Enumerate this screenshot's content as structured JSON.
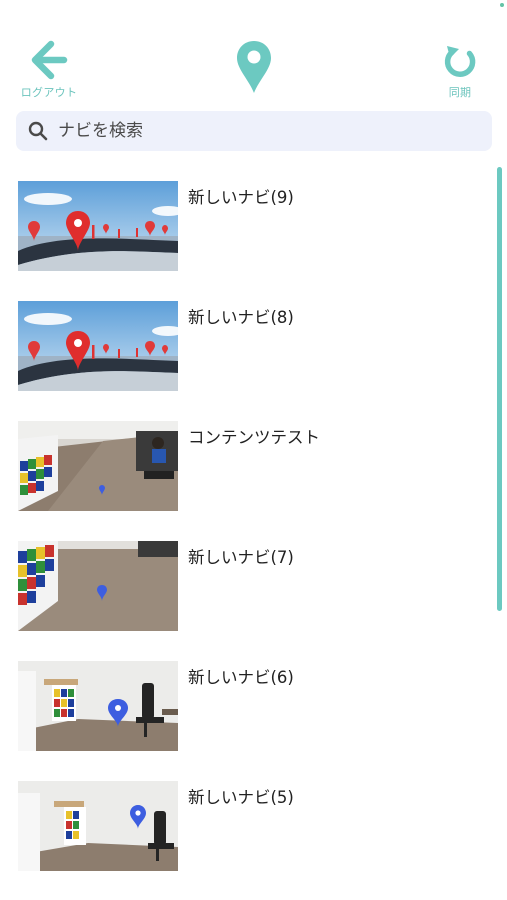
{
  "header": {
    "back_label": "ログアウト",
    "sync_label": "同期",
    "accent_color": "#6cc9c1",
    "back_icon": "arrow-left-icon",
    "logo_icon": "map-pin-icon",
    "sync_icon": "refresh-icon"
  },
  "search": {
    "placeholder": "ナビを検索",
    "value": "",
    "icon": "search-icon"
  },
  "items": [
    {
      "title": "新しいナビ(9)",
      "thumbnail": "map-pins-road-photo"
    },
    {
      "title": "新しいナビ(8)",
      "thumbnail": "map-pins-road-photo"
    },
    {
      "title": "コンテンツテスト",
      "thumbnail": "office-floor-photo"
    },
    {
      "title": "新しいナビ(7)",
      "thumbnail": "office-floor-photo"
    },
    {
      "title": "新しいナビ(6)",
      "thumbnail": "office-room-photo"
    },
    {
      "title": "新しいナビ(5)",
      "thumbnail": "office-room-photo"
    }
  ]
}
